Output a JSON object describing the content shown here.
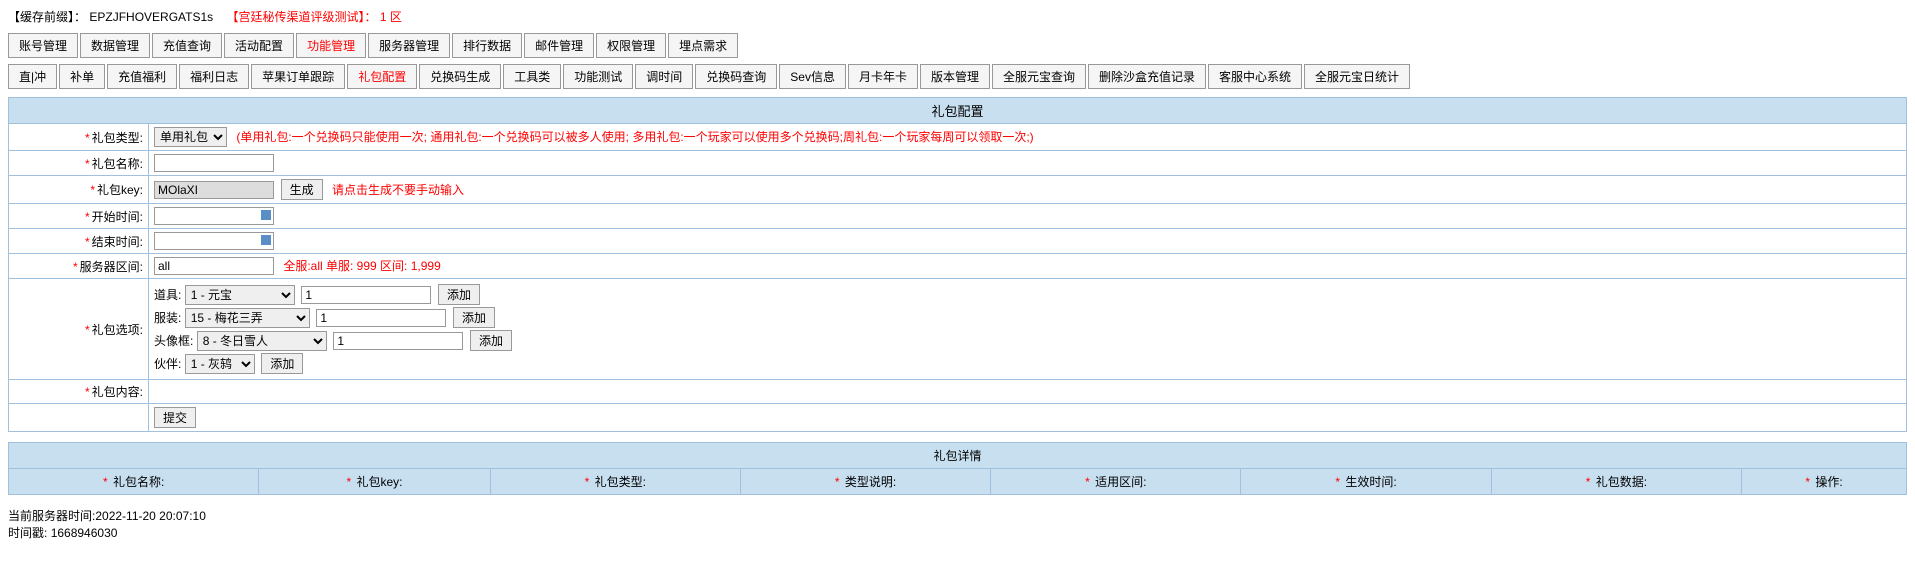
{
  "header": {
    "cache_prefix_label": "【缓存前缀】：",
    "cache_prefix_value": "EPZJFHOVERGATS1s",
    "server_label": "【宫廷秘传渠道评级测试】：",
    "server_value": "1 区"
  },
  "main_tabs": [
    {
      "label": "账号管理",
      "active": false
    },
    {
      "label": "数据管理",
      "active": false
    },
    {
      "label": "充值查询",
      "active": false
    },
    {
      "label": "活动配置",
      "active": false
    },
    {
      "label": "功能管理",
      "active": true
    },
    {
      "label": "服务器管理",
      "active": false
    },
    {
      "label": "排行数据",
      "active": false
    },
    {
      "label": "邮件管理",
      "active": false
    },
    {
      "label": "权限管理",
      "active": false
    },
    {
      "label": "埋点需求",
      "active": false
    }
  ],
  "sub_tabs": [
    {
      "label": "直|冲",
      "active": false
    },
    {
      "label": "补单",
      "active": false
    },
    {
      "label": "充值福利",
      "active": false
    },
    {
      "label": "福利日志",
      "active": false
    },
    {
      "label": "苹果订单跟踪",
      "active": false
    },
    {
      "label": "礼包配置",
      "active": true
    },
    {
      "label": "兑换码生成",
      "active": false
    },
    {
      "label": "工具类",
      "active": false
    },
    {
      "label": "功能测试",
      "active": false
    },
    {
      "label": "调时间",
      "active": false
    },
    {
      "label": "兑换码查询",
      "active": false
    },
    {
      "label": "Sev信息",
      "active": false
    },
    {
      "label": "月卡年卡",
      "active": false
    },
    {
      "label": "版本管理",
      "active": false
    },
    {
      "label": "全服元宝查询",
      "active": false
    },
    {
      "label": "删除沙盒充值记录",
      "active": false
    },
    {
      "label": "客服中心系统",
      "active": false
    },
    {
      "label": "全服元宝日统计",
      "active": false
    }
  ],
  "form": {
    "section_title": "礼包配置",
    "type_label": "礼包类型:",
    "type_value": "单用礼包",
    "type_hint": "(单用礼包:一个兑换码只能使用一次; 通用礼包:一个兑换码可以被多人使用; 多用礼包:一个玩家可以使用多个兑换码;周礼包:一个玩家每周可以领取一次;)",
    "name_label": "礼包名称:",
    "name_value": "",
    "key_label": "礼包key:",
    "key_value": "MOlaXI",
    "key_btn": "生成",
    "key_hint": "请点击生成不要手动输入",
    "start_label": "开始时间:",
    "start_value": "",
    "end_label": "结束时间:",
    "end_value": "",
    "zone_label": "服务器区间:",
    "zone_value": "all",
    "zone_hint": "全服:all 单服: 999 区间: 1,999",
    "options_label": "礼包选项:",
    "content_label": "礼包内容:",
    "submit": "提交",
    "add_btn": "添加",
    "item_row": {
      "label": "道具:",
      "select": "1 - 元宝",
      "qty": "1"
    },
    "cloth_row": {
      "label": "服装:",
      "select": "15 - 梅花三弄",
      "qty": "1"
    },
    "frame_row": {
      "label": "头像框:",
      "select": "8 - 冬日雪人",
      "qty": "1"
    },
    "partner_row": {
      "label": "伙伴:",
      "select": "1 - 灰鸫"
    }
  },
  "detail": {
    "title": "礼包详情",
    "columns": [
      "礼包名称:",
      "礼包key:",
      "礼包类型:",
      "类型说明:",
      "适用区间:",
      "生效时间:",
      "礼包数据:",
      "操作:"
    ]
  },
  "footer": {
    "server_time_label": "当前服务器时间:",
    "server_time_value": "2022-11-20 20:07:10",
    "timestamp_label": "时间戳:",
    "timestamp_value": "1668946030"
  }
}
